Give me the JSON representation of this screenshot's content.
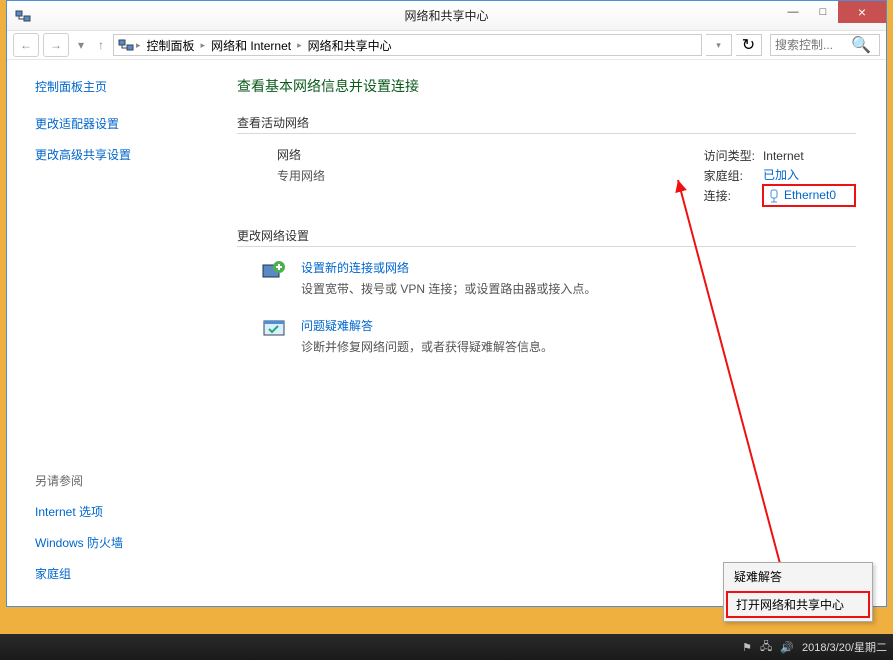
{
  "window": {
    "title": "网络和共享中心",
    "buttons": {
      "min": "—",
      "max": "□",
      "close": "×"
    }
  },
  "breadcrumb": {
    "segments": [
      "控制面板",
      "网络和 Internet",
      "网络和共享中心"
    ],
    "search_placeholder": "搜索控制..."
  },
  "sidebar": {
    "home": "控制面板主页",
    "links": [
      "更改适配器设置",
      "更改高级共享设置"
    ],
    "see_also_header": "另请参阅",
    "see_also": [
      "Internet 选项",
      "Windows 防火墙",
      "家庭组"
    ]
  },
  "main": {
    "heading": "查看基本网络信息并设置连接",
    "active_section": "查看活动网络",
    "network": {
      "name": "网络",
      "type": "专用网络"
    },
    "details": {
      "access_label": "访问类型:",
      "access_value": "Internet",
      "homegroup_label": "家庭组:",
      "homegroup_value": "已加入",
      "connection_label": "连接:",
      "connection_value": "Ethernet0"
    },
    "change_section": "更改网络设置",
    "tasks": [
      {
        "link": "设置新的连接或网络",
        "desc": "设置宽带、拨号或 VPN 连接；或设置路由器或接入点。"
      },
      {
        "link": "问题疑难解答",
        "desc": "诊断并修复网络问题，或者获得疑难解答信息。"
      }
    ]
  },
  "context_menu": {
    "items": [
      "疑难解答",
      "打开网络和共享中心"
    ]
  },
  "taskbar": {
    "datetime": "2018/3/20/星期二"
  }
}
